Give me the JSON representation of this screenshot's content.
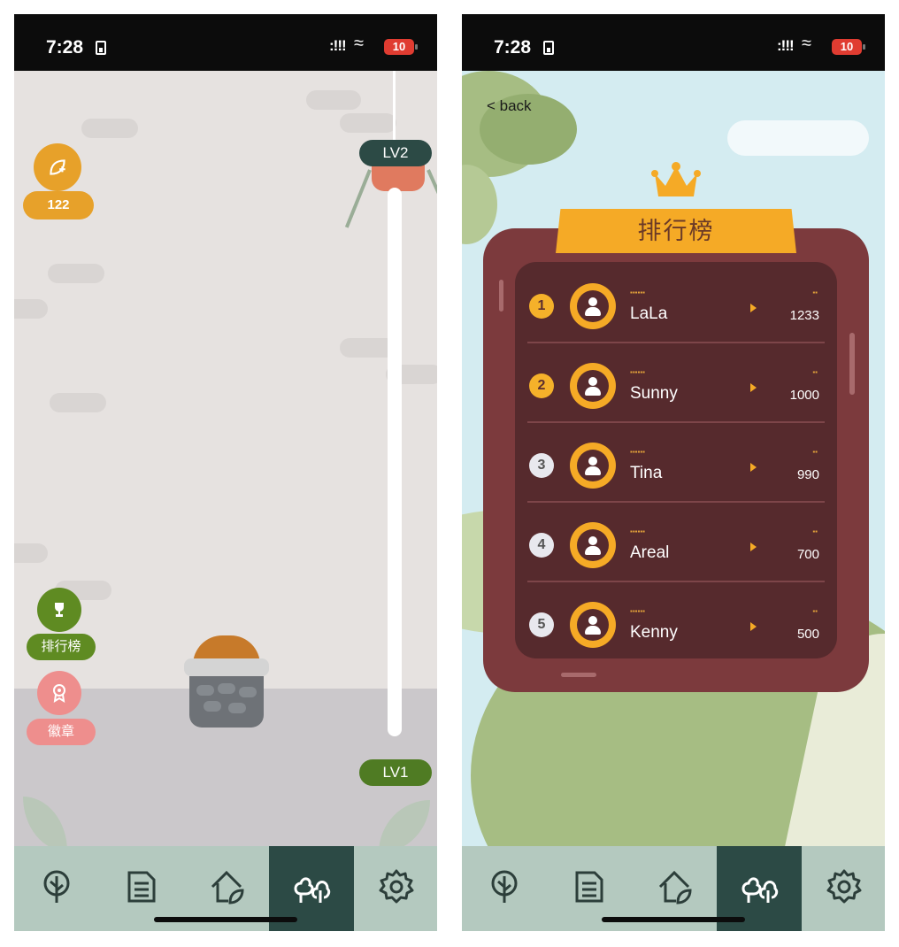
{
  "status_bar": {
    "time": "7:28",
    "battery": "10"
  },
  "left_screen": {
    "points": {
      "value": "122"
    },
    "side_buttons": {
      "ranking_label": "排行榜",
      "badge_label": "徽章"
    },
    "level": {
      "top": "LV2",
      "bottom": "LV1"
    }
  },
  "right_screen": {
    "back_label": "< back",
    "leaderboard_title": "排行榜",
    "rows": [
      {
        "rank": "1",
        "name": "LaLa",
        "score": "1233",
        "medal": "gold"
      },
      {
        "rank": "2",
        "name": "Sunny",
        "score": "1000",
        "medal": "gold"
      },
      {
        "rank": "3",
        "name": "Tina",
        "score": "990",
        "medal": "silver"
      },
      {
        "rank": "4",
        "name": "Areal",
        "score": "700",
        "medal": "silver"
      },
      {
        "rank": "5",
        "name": "Kenny",
        "score": "500",
        "medal": "silver"
      }
    ]
  },
  "tab_bar": {
    "tabs": [
      {
        "icon": "tree-icon"
      },
      {
        "icon": "document-icon"
      },
      {
        "icon": "home-leaf-icon"
      },
      {
        "icon": "forest-icon",
        "active": true
      },
      {
        "icon": "gear-icon"
      }
    ]
  },
  "colors": {
    "accent_orange": "#f5aa26",
    "accent_green": "#5f8b22",
    "accent_pink": "#ee8e8d",
    "tab_active": "#2c4a45",
    "tab_bar": "#b4c9bf",
    "board": "#7c3a3d"
  }
}
